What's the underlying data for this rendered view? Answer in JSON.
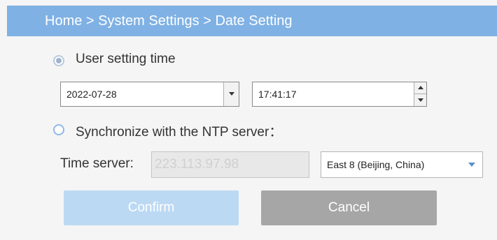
{
  "breadcrumb": {
    "text": "Home > System Settings > Date Setting"
  },
  "mode_user": {
    "label": "User setting time",
    "selected": true
  },
  "date_field": {
    "value": "2022-07-28"
  },
  "time_field": {
    "value": "17:41:17"
  },
  "mode_ntp": {
    "label": "Synchronize with the NTP server：",
    "selected": false
  },
  "time_server": {
    "label": "Time server:",
    "value": "223.113.97.98"
  },
  "timezone": {
    "value": "East 8 (Beijing, China)"
  },
  "actions": {
    "confirm": "Confirm",
    "cancel": "Cancel"
  },
  "colors": {
    "header": "#7fb1e4",
    "confirm_disabled": "#bcd9f3",
    "cancel": "#a6a6a6",
    "dropdown_caret": "#5b8fd0"
  }
}
